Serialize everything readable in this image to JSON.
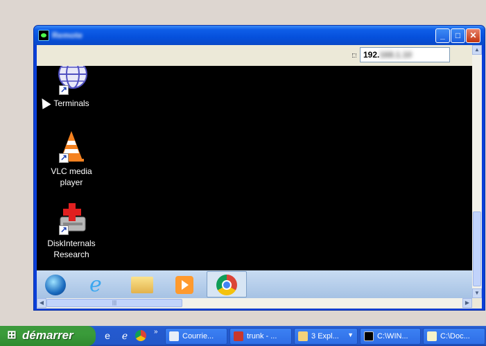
{
  "window": {
    "title": "Remote ",
    "address_value": "192.",
    "address_hidden": "168.1.10"
  },
  "desktop_icons": [
    {
      "label": "Terminals",
      "icon": "terminals-globe-icon"
    },
    {
      "label": "VLC media player",
      "icon": "vlc-cone-icon"
    },
    {
      "label": "DiskInternals Research",
      "icon": "diskinternals-icon"
    }
  ],
  "remote_taskbar": [
    {
      "icon": "windows-orb-icon"
    },
    {
      "icon": "internet-explorer-icon"
    },
    {
      "icon": "folder-icon"
    },
    {
      "icon": "media-player-icon"
    },
    {
      "icon": "chrome-icon",
      "active": true
    }
  ],
  "taskbar": {
    "start_label": "démarrer",
    "quick_launch": [
      "ie-alt-icon",
      "ie-icon",
      "chrome-icon"
    ],
    "more": "»",
    "buttons": [
      {
        "label": "Courrie...",
        "icon": "mail-icon"
      },
      {
        "label": "trunk - ...",
        "icon": "pdf-icon"
      },
      {
        "count": "3",
        "label": "Expl...",
        "icon": "folder-icon"
      },
      {
        "label": "C:\\WIN...",
        "icon": "console-icon"
      },
      {
        "label": "C:\\Doc...",
        "icon": "notepad-icon"
      }
    ]
  },
  "colors": {
    "desktop_bg": "#ddd6d0",
    "window_frame": "#0a3fd8",
    "remote_screen": "#000000",
    "taskbar": "#245ad0",
    "start_button": "#3a9b3a"
  }
}
